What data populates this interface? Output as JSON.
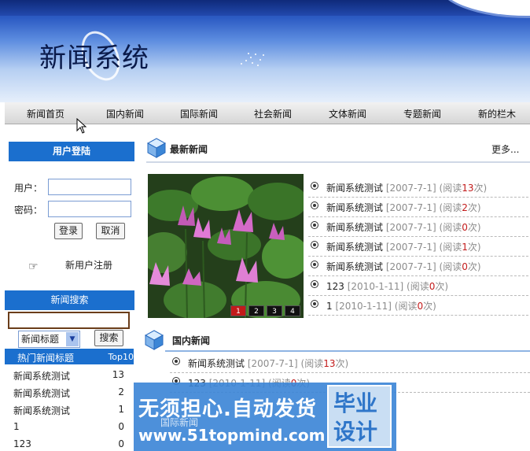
{
  "banner": {
    "title": "新闻系统"
  },
  "nav": {
    "items": [
      "新闻首页",
      "国内新闻",
      "国际新闻",
      "社会新闻",
      "文体新闻",
      "专题新闻",
      "新的栏木"
    ]
  },
  "login": {
    "title": "用户登陆",
    "user_label": "用户：",
    "pass_label": "密码：",
    "login_button": "登录",
    "cancel_button": "取消",
    "register_label": "新用户注册"
  },
  "search": {
    "title": "新闻搜索",
    "input_value": "",
    "select_value": "新闻标题",
    "search_button": "搜索"
  },
  "hot": {
    "title": "热门新闻标题",
    "top_label": "Top10",
    "rows": [
      {
        "title": "新闻系统测试",
        "count": "13"
      },
      {
        "title": "新闻系统测试",
        "count": "2"
      },
      {
        "title": "新闻系统测试",
        "count": "1"
      },
      {
        "title": "1",
        "count": "0"
      },
      {
        "title": "123",
        "count": "0"
      }
    ]
  },
  "latest": {
    "title": "最新新闻",
    "more": "更多...",
    "photo_nums": [
      "1",
      "2",
      "3",
      "4"
    ],
    "items": [
      {
        "title": "新闻系统测试",
        "date": "[2007-7-1]",
        "read_pre": "(阅读",
        "count": "13",
        "read_post": "次)"
      },
      {
        "title": "新闻系统测试",
        "date": "[2007-7-1]",
        "read_pre": "(阅读",
        "count": "2",
        "read_post": "次)"
      },
      {
        "title": "新闻系统测试",
        "date": "[2007-7-1]",
        "read_pre": "(阅读",
        "count": "0",
        "read_post": "次)"
      },
      {
        "title": "新闻系统测试",
        "date": "[2007-7-1]",
        "read_pre": "(阅读",
        "count": "1",
        "read_post": "次)"
      },
      {
        "title": "新闻系统测试",
        "date": "[2007-7-1]",
        "read_pre": "(阅读",
        "count": "0",
        "read_post": "次)"
      },
      {
        "title": "123",
        "date": "[2010-1-11]",
        "read_pre": "(阅读",
        "count": "0",
        "read_post": "次)"
      },
      {
        "title": "1",
        "date": "[2010-1-11]",
        "read_pre": "(阅读",
        "count": "0",
        "read_post": "次)"
      }
    ]
  },
  "domestic": {
    "title": "国内新闻",
    "items": [
      {
        "title": "新闻系统测试",
        "date": "[2007-7-1]",
        "read_pre": "(阅读",
        "count": "13",
        "read_post": "次)"
      },
      {
        "title": "123",
        "date": "[2010-1-11]",
        "read_pre": "(阅读",
        "count": "0",
        "read_post": "次)"
      }
    ]
  },
  "international": {
    "title": "国际新闻"
  },
  "watermark": {
    "line1": "无须担心.自动发货",
    "line2": "www.51topmind.com",
    "box1": "毕业",
    "box2": "设计"
  },
  "colors": {
    "nav_bar": "#d6d6d6",
    "panel_head": "#1b6fce",
    "read_count": "#c21a1a"
  }
}
